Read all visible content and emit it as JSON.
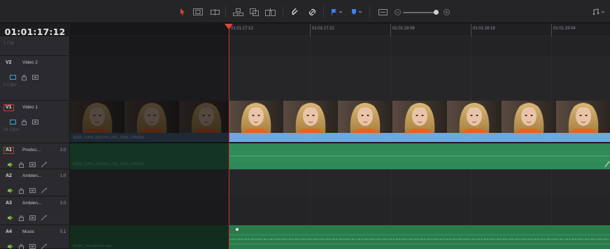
{
  "timecode": "01:01:17:12",
  "ruler": {
    "ghost_label": "",
    "labels": [
      "01:01:17:12",
      "01:01:17:22",
      "01:01:18:08",
      "01:01:18:18",
      "01:01:19:04"
    ]
  },
  "tracks": {
    "top_partial": {
      "clips": "1 Clip"
    },
    "v2": {
      "id": "V2",
      "name": "Video 2",
      "clips": "0 Clips"
    },
    "v1": {
      "id": "V1",
      "name": "Video 1",
      "clips": "24 Clips",
      "clip_name": "A002_C009_0912XN_001_1080_ORIGIN"
    },
    "a1": {
      "id": "A1",
      "name": "Produc...",
      "vol": "2.0",
      "clip_name": "A002_C009_0912XN_001_1080_ORIGIN"
    },
    "a2": {
      "id": "A2",
      "name": "Ambien...",
      "vol": "1.0"
    },
    "a3": {
      "id": "A3",
      "name": "Ambien...",
      "vol": "2.0"
    },
    "a4": {
      "id": "A4",
      "name": "Music",
      "vol": "5.1",
      "clip_name": "Audio_Soundtrack.wav"
    }
  },
  "toolbar": {
    "icons": [
      "select-arrow-icon",
      "trim-icon",
      "blade-icon",
      "insert-icon",
      "overwrite-icon",
      "replace-icon",
      "snap-icon",
      "link-icon",
      "flag-icon",
      "marker-icon",
      "zoom-full-icon",
      "zoom-out-icon",
      "zoom-in-icon",
      "audio-icon"
    ]
  },
  "colors": {
    "playhead": "#e0443a",
    "video_strip": "#6fa7e0",
    "audio_clip": "#2f8a58",
    "selected_track_outline": "#c0392b",
    "flag": "#3b82f6"
  }
}
